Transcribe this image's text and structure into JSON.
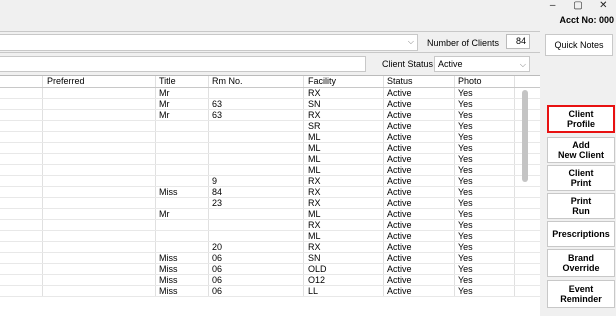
{
  "window": {
    "controls": [
      "–",
      "▢",
      "✕"
    ],
    "acct_label": "Acct No: 000"
  },
  "filters": {
    "number_of_clients_label": "Number of Clients",
    "number_of_clients_value": "84",
    "client_status_label": "Client Status",
    "client_status_value": "Active"
  },
  "table": {
    "columns": [
      "",
      "Preferred",
      "Title",
      "Rm No.",
      "Facility",
      "Status",
      "Photo"
    ],
    "rows": [
      [
        "",
        "",
        "Mr",
        "",
        "RX",
        "Active",
        "Yes"
      ],
      [
        "",
        "",
        "Mr",
        "63",
        "SN",
        "Active",
        "Yes"
      ],
      [
        "",
        "",
        "Mr",
        "63",
        "RX",
        "Active",
        "Yes"
      ],
      [
        "",
        "",
        "",
        "",
        "SR",
        "Active",
        "Yes"
      ],
      [
        "",
        "",
        "",
        "",
        "ML",
        "Active",
        "Yes"
      ],
      [
        "",
        "",
        "",
        "",
        "ML",
        "Active",
        "Yes"
      ],
      [
        "",
        "",
        "",
        "",
        "ML",
        "Active",
        "Yes"
      ],
      [
        "",
        "",
        "",
        "",
        "ML",
        "Active",
        "Yes"
      ],
      [
        "",
        "",
        "",
        "9",
        "RX",
        "Active",
        "Yes"
      ],
      [
        "",
        "",
        "Miss",
        "84",
        "RX",
        "Active",
        "Yes"
      ],
      [
        "",
        "",
        "",
        "23",
        "RX",
        "Active",
        "Yes"
      ],
      [
        "",
        "",
        "Mr",
        "",
        "ML",
        "Active",
        "Yes"
      ],
      [
        "",
        "",
        "",
        "",
        "RX",
        "Active",
        "Yes"
      ],
      [
        "",
        "",
        "",
        "",
        "ML",
        "Active",
        "Yes"
      ],
      [
        "",
        "",
        "",
        "20",
        "RX",
        "Active",
        "Yes"
      ],
      [
        "",
        "",
        "Miss",
        "06",
        "SN",
        "Active",
        "Yes"
      ],
      [
        "",
        "",
        "Miss",
        "06",
        "OLD",
        "Active",
        "Yes"
      ],
      [
        "",
        "",
        "Miss",
        "06",
        "O12",
        "Active",
        "Yes"
      ],
      [
        "",
        "",
        "Miss",
        "06",
        "LL",
        "Active",
        "Yes"
      ]
    ]
  },
  "sidebar": {
    "quick_notes": "Quick Notes",
    "buttons": [
      {
        "label": "Client\nProfile",
        "active": true
      },
      {
        "label": "Add\nNew Client",
        "active": false
      },
      {
        "label": "Client\nPrint",
        "active": false
      },
      {
        "label": "Print\nRun",
        "active": false
      },
      {
        "label": "Prescriptions",
        "active": false
      },
      {
        "label": "Brand\nOverride",
        "active": false
      },
      {
        "label": "Event\nReminder",
        "active": false
      }
    ]
  },
  "colors": {
    "active_border": "#e81111",
    "background": "#f0f0f0"
  }
}
